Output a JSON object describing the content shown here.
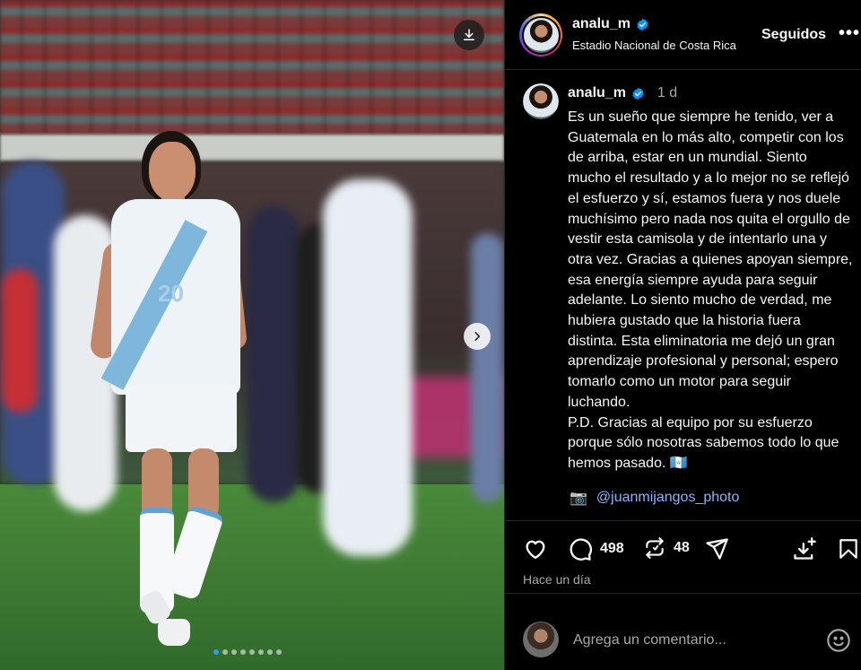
{
  "post": {
    "username": "analu_m",
    "location": "Estadio Nacional de Costa Rica",
    "follow_label": "Seguidos",
    "more_label": "•••",
    "caption_time": "1 d",
    "caption_text": "Es un sueño que siempre he tenido, ver a Guatemala en lo más alto, competir con los de arriba, estar en un mundial. Siento mucho el resultado y a lo mejor no se reflejó el esfuerzo y sí, estamos fuera y nos duele muchísimo pero nada nos quita el orgullo de vestir esta camisola y de intentarlo una y otra vez. Gracias a quienes apoyan siempre, esa energía siempre ayuda para seguir adelante. Lo siento mucho de verdad, me hubiera gustado que la historia fuera distinta. Esta eliminatoria me dejó un gran aprendizaje profesional y personal; espero tomarlo como un motor para seguir luchando.\nP.D. Gracias al equipo por su esfuerzo porque sólo  nosotras sabemos todo lo que hemos pasado. 🇬🇹",
    "credit_icon": "📷",
    "credit_link": "@juanmijangos_photo",
    "jersey_number": "20"
  },
  "actions": {
    "comments_count": "498",
    "reposts_count": "48",
    "time_ago": "Hace un día"
  },
  "comment": {
    "placeholder": "Agrega un comentario..."
  },
  "carousel": {
    "total_slides": 8,
    "active_index": 0
  },
  "colors": {
    "background": "#000000",
    "verified": "#0095f6",
    "link": "#8ab4ff",
    "muted": "#a8a8a8"
  }
}
